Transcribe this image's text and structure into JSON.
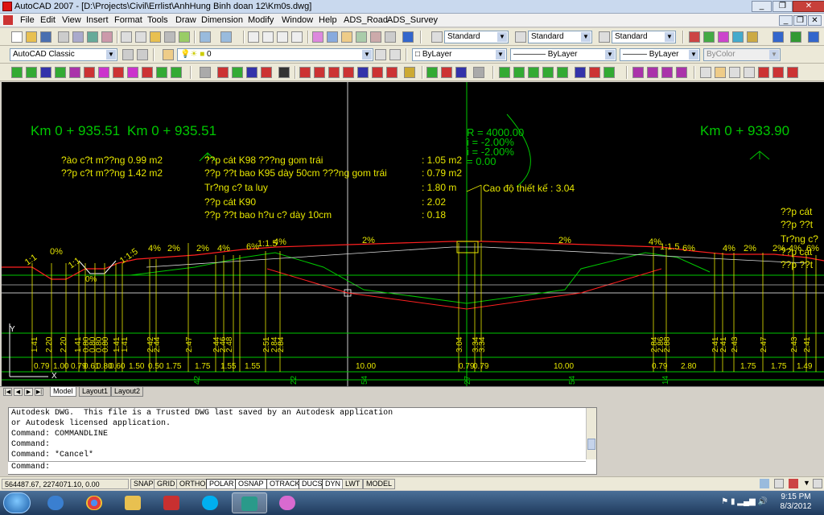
{
  "window": {
    "title": "AutoCAD 2007 - [D:\\Projects\\Civil\\Errlist\\AnhHung Binh doan 12\\Km0s.dwg]",
    "minimize": "_",
    "restore": "❐",
    "close": "✕",
    "doc_minimize": "_",
    "doc_restore": "❐",
    "doc_close": "✕"
  },
  "menu": [
    "File",
    "Edit",
    "View",
    "Insert",
    "Format",
    "Tools",
    "Draw",
    "Dimension",
    "Modify",
    "Window",
    "Help",
    "ADS_Road",
    "ADS_Survey"
  ],
  "toolbar": {
    "text_style": "Standard",
    "dim_style": "Standard",
    "table_style": "Standard",
    "workspace": "AutoCAD Classic",
    "layer": "0",
    "color": "ByLayer",
    "linetype": "ByLayer",
    "lineweight": "ByLayer",
    "plotstyle": "ByColor"
  },
  "drawing": {
    "station_left": "Km 0 + 935.51",
    "station_overlap": "Km 0 + 935.51",
    "station_right": "Km 0 + 933.90",
    "curve": [
      "R = 4000.00",
      "i = -2.00%",
      "i = -2.00%",
      "= 0.00"
    ],
    "table_left": [
      "?ào c?t m??ng 0.99 m2",
      "??p c?t m??ng 1.42 m2"
    ],
    "table_mid": [
      "??p cát K98 ???ng gom trái",
      "??p ??t bao K95 dày 50cm ???ng gom trái",
      "Tr?ng c? ta luy",
      "??p cát K90",
      "??p ??t bao h?u c? dày 10cm"
    ],
    "table_vals": [
      ": 1.05 m2",
      ": 0.79 m2",
      ": 1.80 m",
      ": 2.02",
      ": 0.18"
    ],
    "right_labels": [
      "??p cát",
      "??p ??t",
      "Tr?ng c?",
      "??p cát",
      "??p ??t"
    ],
    "elevation_label": "Cao độ thiết kế : 3.04",
    "slopes": [
      "1:1",
      "0%",
      "1:1",
      "1:1:5",
      "4%",
      "2%",
      "2%",
      "4%",
      "6%",
      "1:1.5",
      "4%",
      "2%",
      "2%",
      "4%",
      "1:1.5",
      "6%",
      "4%",
      "2%",
      "2%",
      "4%",
      "6%"
    ],
    "levels": [
      "1.41",
      "2.20",
      "2.20",
      "1.41",
      "0.80",
      "0.80",
      "0.80",
      "0.80",
      "1.41",
      "1.41",
      "2.42",
      "2.44",
      "2.47",
      "2.44",
      "2.46",
      "2.48",
      "2.51",
      "2.84",
      "2.84",
      "3.04",
      "3.34",
      "3.34",
      "2.84",
      "2.86",
      "2.88",
      "2.41",
      "2.41",
      "2.43",
      "2.47",
      "2.43",
      "2.41"
    ],
    "widths": [
      "0.79",
      "1.00",
      "0.79",
      "0.61",
      "0.80",
      "0.60",
      "1.50",
      "0.50",
      "1.75",
      "1.75",
      "1.55",
      "1.55",
      "10.00",
      "0.79",
      "0.79",
      "10.00",
      "0.79",
      "2.80",
      "1.75",
      "1.75",
      "1.49"
    ],
    "bottom_marks": [
      "42",
      "22",
      "54",
      "27",
      "54",
      "14"
    ],
    "crosshair_label": "Y",
    "axis_x": "X"
  },
  "layout_tabs": [
    "Model",
    "Layout1",
    "Layout2"
  ],
  "command_lines": [
    "Autodesk DWG.  This file is a Trusted DWG last saved by an Autodesk application",
    "or Autodesk licensed application.",
    "Command: COMMANDLINE",
    "Command:",
    "Command: *Cancel*"
  ],
  "command_prompt": "Command:",
  "status": {
    "coords": "564487.67, 2274071.10, 0.00",
    "buttons": [
      "SNAP",
      "GRID",
      "ORTHO",
      "POLAR",
      "OSNAP",
      "OTRACK",
      "DUCS",
      "DYN",
      "LWT",
      "MODEL"
    ],
    "active": [
      "POLAR",
      "OSNAP",
      "OTRACK",
      "DUCS",
      "DYN"
    ]
  },
  "taskbar": {
    "time": "9:15 PM",
    "date": "8/3/2012",
    "apps": [
      "ie-icon",
      "chrome-icon",
      "explorer-icon",
      "tools-icon",
      "skype-icon",
      "autocad-icon",
      "paint-icon"
    ]
  },
  "colors": {
    "canvas_bg": "#000000",
    "cad_green": "#00c800",
    "cad_yellow": "#e6e600",
    "cad_red": "#ff2020",
    "cad_white": "#ffffff"
  }
}
